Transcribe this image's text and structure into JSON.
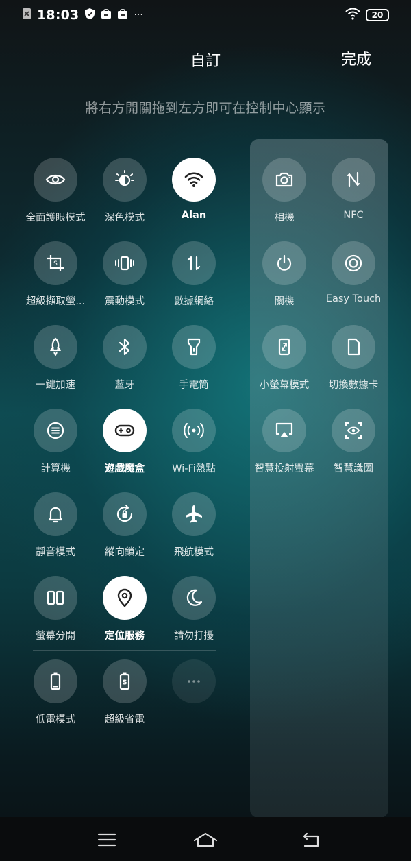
{
  "status_bar": {
    "time": "18:03",
    "notif_dots": "···",
    "battery_level": "20"
  },
  "header": {
    "title": "自訂",
    "done_label": "完成"
  },
  "hint": "將右方開關拖到左方即可在控制中心顯示",
  "left_tiles": [
    {
      "label": "全面護眼模式",
      "icon": "eye-icon",
      "active": false
    },
    {
      "label": "深色模式",
      "icon": "dark-mode-icon",
      "active": false
    },
    {
      "label": "Alan",
      "icon": "wifi-icon",
      "active": true
    },
    {
      "label": "超級擷取螢...",
      "icon": "screenshot-crop-icon",
      "active": false
    },
    {
      "label": "震動模式",
      "icon": "vibrate-icon",
      "active": false
    },
    {
      "label": "數據網絡",
      "icon": "data-arrows-icon",
      "active": false
    },
    {
      "label": "一鍵加速",
      "icon": "rocket-icon",
      "active": false
    },
    {
      "label": "藍牙",
      "icon": "bluetooth-icon",
      "active": false
    },
    {
      "label": "手電筒",
      "icon": "flashlight-icon",
      "active": false
    },
    {
      "label": "計算機",
      "icon": "calculator-icon",
      "active": false
    },
    {
      "label": "遊戲魔盒",
      "icon": "gamepad-icon",
      "active": true
    },
    {
      "label": "Wi-Fi熱點",
      "icon": "hotspot-icon",
      "active": false
    },
    {
      "label": "靜音模式",
      "icon": "bell-icon",
      "active": false
    },
    {
      "label": "縱向鎖定",
      "icon": "rotation-lock-icon",
      "active": false
    },
    {
      "label": "飛航模式",
      "icon": "airplane-icon",
      "active": false
    },
    {
      "label": "螢幕分開",
      "icon": "split-screen-icon",
      "active": false
    },
    {
      "label": "定位服務",
      "icon": "location-icon",
      "active": true
    },
    {
      "label": "請勿打擾",
      "icon": "moon-icon",
      "active": false
    },
    {
      "label": "低電模式",
      "icon": "battery-low-icon",
      "active": false
    },
    {
      "label": "超級省電",
      "icon": "battery-saver-icon",
      "active": false
    },
    {
      "label": "",
      "icon": "more-icon",
      "active": false
    }
  ],
  "right_tiles": [
    {
      "label": "相機",
      "icon": "camera-icon"
    },
    {
      "label": "NFC",
      "icon": "nfc-icon"
    },
    {
      "label": "關機",
      "icon": "power-icon"
    },
    {
      "label": "Easy Touch",
      "icon": "easy-touch-icon"
    },
    {
      "label": "小螢幕模式",
      "icon": "small-screen-icon"
    },
    {
      "label": "切換數據卡",
      "icon": "sim-card-icon"
    },
    {
      "label": "智慧投射螢幕",
      "icon": "screen-cast-icon"
    },
    {
      "label": "智慧識圖",
      "icon": "scan-eye-icon"
    }
  ],
  "colors": {
    "accent_active": "#ffffff",
    "tile_bg": "rgba(255,255,255,0.18)"
  }
}
